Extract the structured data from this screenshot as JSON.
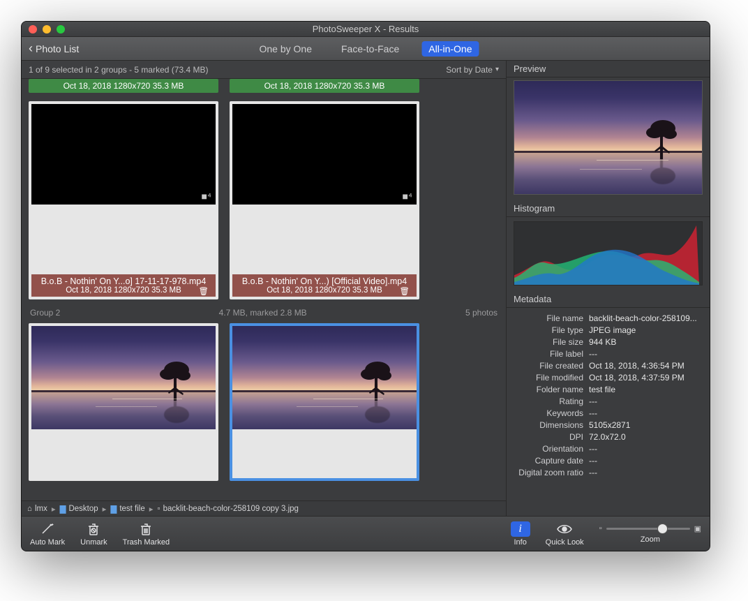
{
  "window": {
    "title": "PhotoSweeper X - Results"
  },
  "toolbar": {
    "back_label": "Photo List",
    "tabs": [
      {
        "label": "One by One",
        "active": false
      },
      {
        "label": "Face-to-Face",
        "active": false
      },
      {
        "label": "All-in-One",
        "active": true
      }
    ]
  },
  "status": {
    "selection": "1 of 9 selected in 2 groups - 5 marked (73.4 MB)",
    "sort_label": "Sort by Date"
  },
  "group1": {
    "green_meta": "Oct 18, 2018  1280x720  35.3 MB",
    "items": [
      {
        "filename": "B.o.B - Nothin' On Y...o] 17-11-17-978.mp4",
        "meta": "Oct 18, 2018  1280x720  35.3 MB"
      },
      {
        "filename": "B.o.B - Nothin' On Y...) [Official Video].mp4",
        "meta": "Oct 18, 2018  1280x720  35.3 MB"
      }
    ]
  },
  "group2": {
    "header_label": "Group 2",
    "header_mid": "4.7 MB, marked 2.8 MB",
    "header_right": "5 photos"
  },
  "breadcrumb": {
    "home": "lmx",
    "items": [
      "Desktop",
      "test file"
    ],
    "file": "backlit-beach-color-258109 copy 3.jpg"
  },
  "bottom": {
    "auto_mark": "Auto Mark",
    "unmark": "Unmark",
    "trash_marked": "Trash Marked",
    "info": "Info",
    "quick_look": "Quick Look",
    "zoom": "Zoom"
  },
  "right": {
    "preview_title": "Preview",
    "histogram_title": "Histogram",
    "metadata_title": "Metadata",
    "metadata": [
      {
        "k": "File name",
        "v": "backlit-beach-color-258109..."
      },
      {
        "k": "File type",
        "v": "JPEG image"
      },
      {
        "k": "File size",
        "v": "944 KB"
      },
      {
        "k": "File label",
        "v": "---"
      },
      {
        "k": "File created",
        "v": "Oct 18, 2018, 4:36:54 PM"
      },
      {
        "k": "File modified",
        "v": "Oct 18, 2018, 4:37:59 PM"
      },
      {
        "k": "Folder name",
        "v": "test file"
      },
      {
        "k": "Rating",
        "v": "---"
      },
      {
        "k": "Keywords",
        "v": "---"
      },
      {
        "k": "Dimensions",
        "v": "5105x2871"
      },
      {
        "k": "DPI",
        "v": "72.0x72.0"
      },
      {
        "k": "Orientation",
        "v": "---"
      },
      {
        "k": "Capture date",
        "v": "---"
      },
      {
        "k": "Digital zoom ratio",
        "v": "---"
      }
    ]
  }
}
